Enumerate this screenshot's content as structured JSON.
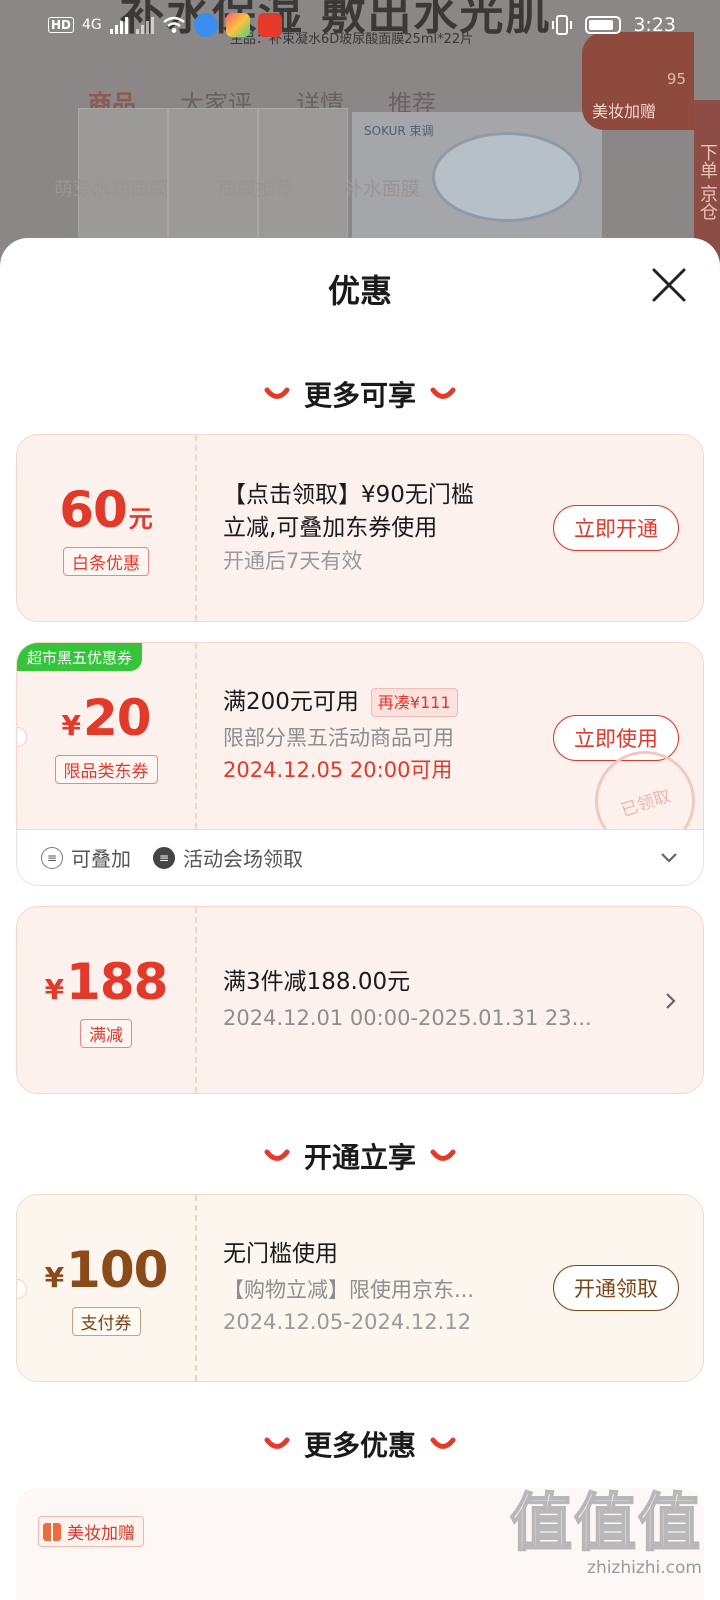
{
  "background": {
    "headline": "补水保湿 敷出水光肌",
    "subtitle": "主品：补束凝水6D玻尿酸面膜25ml*22片",
    "tabs": [
      "商品",
      "大家评",
      "详情",
      "推荐"
    ],
    "product_brand": "SOKUR 束调",
    "search_hints": [
      "萌芽水润面膜",
      "面膜推荐",
      "补水面膜"
    ],
    "badge_number": "95",
    "badge_label": "美妆加赠",
    "side_text": "下单 京仓"
  },
  "status_bar": {
    "network": "4G",
    "time": "3:23"
  },
  "sheet": {
    "title": "优惠"
  },
  "sections": {
    "more_available": "更多可享",
    "activate_enjoy": "开通立享",
    "more_offers": "更多优惠"
  },
  "coupons": [
    {
      "amount": "60",
      "unit": "元",
      "tag": "白条优惠",
      "line1": "【点击领取】¥90无门槛",
      "line2": "立减,可叠加东券使用",
      "line3": "开通后7天有效",
      "button": "立即开通"
    },
    {
      "corner_tag": "超市黑五优惠券",
      "currency": "¥",
      "amount": "20",
      "tag": "限品类东券",
      "line1": "满200元可用",
      "pill": "再凑¥111",
      "line2": "限部分黑五活动商品可用",
      "line3": "2024.12.05 20:00可用",
      "button": "立即使用",
      "stamp": "已领取",
      "foot": [
        "可叠加",
        "活动会场领取"
      ]
    },
    {
      "currency": "¥",
      "amount": "188",
      "tag": "满减",
      "line1": "满3件减188.00元",
      "line2": "2024.12.01 00:00-2025.01.31 23..."
    },
    {
      "currency": "¥",
      "amount": "100",
      "tag": "支付券",
      "line1": "无门槛使用",
      "line2": "【购物立减】限使用京东...",
      "line3": "2024.12.05-2024.12.12",
      "button": "开通领取"
    }
  ],
  "more_card": {
    "tag": "美妆加赠"
  },
  "watermark": {
    "glyphs": "值值值",
    "url": "zhizhizhi.com"
  },
  "colors": {
    "accent_red": "#e23a2a",
    "gold_brown": "#8b4a1a",
    "green_tag": "#36c43a"
  }
}
